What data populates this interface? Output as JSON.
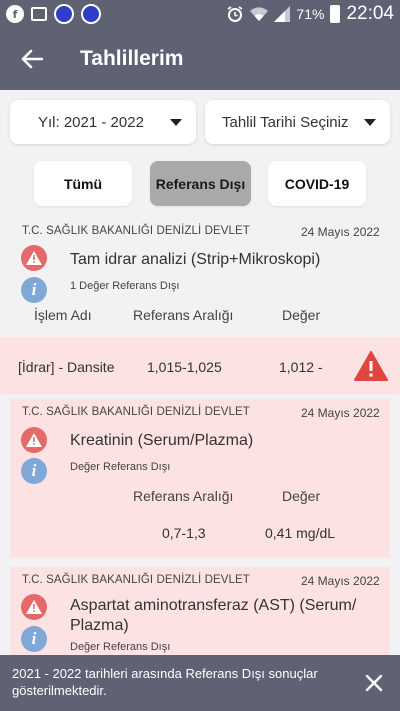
{
  "status_bar": {
    "battery": "71%",
    "time": "22:04"
  },
  "app_bar": {
    "title": "Tahlillerim"
  },
  "filters": {
    "year": "Yıl: 2021 - 2022",
    "date": "Tahlil Tarihi Seçiniz",
    "pills": [
      "Tümü",
      "Referans Dışı",
      "COVID-19"
    ],
    "active_pill": "Referans Dışı"
  },
  "results": [
    {
      "institution": "T.C. SAĞLIK BAKANLIĞI DENİZLİ DEVLET",
      "date": "24 Mayıs 2022",
      "test": "Tam idrar analizi (Strip+Mikroskopi)",
      "note": "1 Değer Referans Dışı",
      "headers": [
        "İşlem Adı",
        "Referans Aralığı",
        "Değer"
      ],
      "rows": [
        {
          "name": "[İdrar] - Dansite",
          "range": "1,015-1,025",
          "value": "1,012 -"
        }
      ]
    },
    {
      "institution": "T.C. SAĞLIK BAKANLIĞI DENİZLİ DEVLET",
      "date": "24 Mayıs 2022",
      "test": "Kreatinin (Serum/Plazma)",
      "note": "Değer Referans Dışı",
      "headers": [
        "Referans Aralığı",
        "Değer"
      ],
      "range": "0,7-1,3",
      "value": "0,41 mg/dL"
    },
    {
      "institution": "T.C. SAĞLIK BAKANLIĞI DENİZLİ DEVLET",
      "date": "24 Mayıs 2022",
      "test_line1": "Aspartat aminotransferaz (AST) (Serum/",
      "test_line2": "Plazma)",
      "note": "Değer Referans Dışı"
    }
  ],
  "snackbar": {
    "message": "2021 - 2022 tarihleri arasında Referans Dışı sonuçlar gösterilmektedir."
  },
  "colors": {
    "header": "#5f6273",
    "out_of_range_bg": "#fce2e3",
    "warning": "#e0453e",
    "info": "#7fa8d8"
  }
}
